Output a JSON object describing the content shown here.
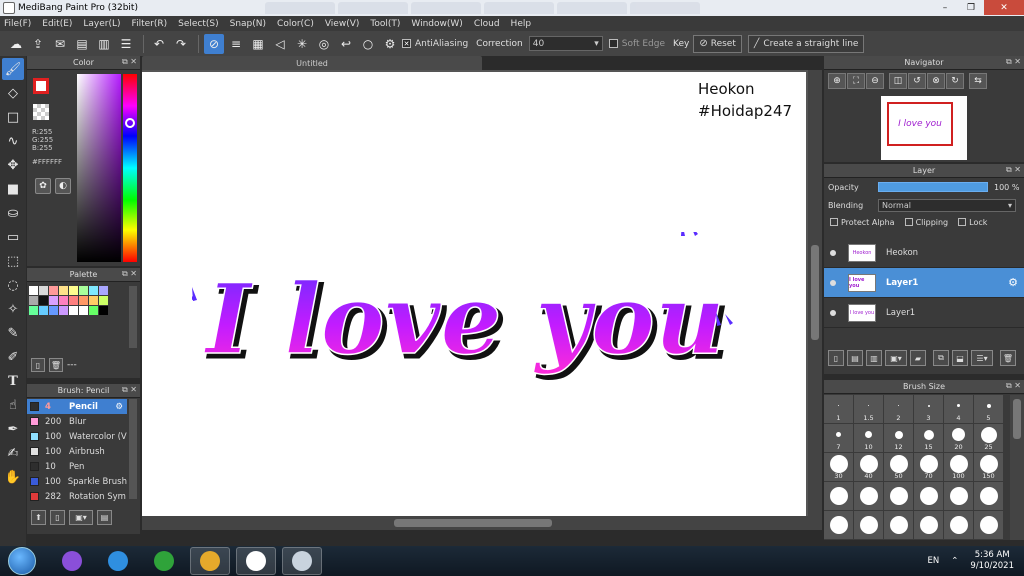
{
  "window": {
    "title": "MediBang Paint Pro (32bit)",
    "controls": [
      "–",
      "❐",
      "✕"
    ]
  },
  "menu": [
    "File(F)",
    "Edit(E)",
    "Layer(L)",
    "Filter(R)",
    "Select(S)",
    "Snap(N)",
    "Color(C)",
    "View(V)",
    "Tool(T)",
    "Window(W)",
    "Cloud",
    "Help"
  ],
  "toolbar": {
    "antialiasing_label": "AntiAliasing",
    "correction_label": "Correction",
    "correction_value": "40",
    "soft_edge_label": "Soft Edge",
    "key_label": "Key",
    "reset_label": "Reset",
    "straight_line_label": "Create a straight line"
  },
  "color_panel": {
    "title": "Color",
    "r": "R:255",
    "g": "G:255",
    "b": "B:255",
    "hex": "#FFFFFF",
    "foreground_color": "#ffffff",
    "accent": "#e02020"
  },
  "palette_panel": {
    "title": "Palette",
    "footer_text": "---",
    "colors": [
      "#ffffff",
      "#d9d9d9",
      "#ff9a9a",
      "#ffe18a",
      "#fffd8f",
      "#a8ff9b",
      "#7fe9ff",
      "#a9a6ff",
      "#aaaaaa",
      "#111111",
      "#d9a0ff",
      "#ff80c0",
      "#ff8080",
      "#ff9966",
      "#ffcc66",
      "#ccff66",
      "#66ff99",
      "#66ccff",
      "#6699ff",
      "#cc99ff",
      "#ffffff",
      "#ffffff",
      "#66ff66",
      "#000000"
    ]
  },
  "brush_panel": {
    "title": "Brush: Pencil",
    "brushes": [
      {
        "size": "4",
        "name": "Pencil",
        "color": "#2e2e2e"
      },
      {
        "size": "200",
        "name": "Blur",
        "color": "#ff9ad8"
      },
      {
        "size": "100",
        "name": "Watercolor (V",
        "color": "#8fe0ff"
      },
      {
        "size": "100",
        "name": "Airbrush",
        "color": "#e0e0e0"
      },
      {
        "size": "10",
        "name": "Pen",
        "color": "#2e2e2e"
      },
      {
        "size": "100",
        "name": "Sparkle Brush",
        "color": "#3a5bd9"
      },
      {
        "size": "282",
        "name": "Rotation Sym",
        "color": "#e03a3a"
      }
    ]
  },
  "document": {
    "tab_title": "Untitled",
    "watermark_line1": "Heokon",
    "watermark_line2": "#Hoidap247",
    "artwork_text": "I love you"
  },
  "navigator_panel": {
    "title": "Navigator",
    "preview_text": "I love you"
  },
  "layer_panel": {
    "title": "Layer",
    "opacity_label": "Opacity",
    "opacity_value": "100 %",
    "blending_label": "Blending",
    "blending_value": "Normal",
    "protect_alpha_label": "Protect Alpha",
    "clipping_label": "Clipping",
    "lock_label": "Lock",
    "layers": [
      {
        "name": "Heokon",
        "thumb": "Heokon",
        "selected": false
      },
      {
        "name": "Layer1",
        "thumb": "I love you",
        "selected": true
      },
      {
        "name": "Layer1",
        "thumb": "I love you",
        "selected": false
      }
    ]
  },
  "brush_size_panel": {
    "title": "Brush Size",
    "sizes": [
      "1",
      "1.5",
      "2",
      "3",
      "4",
      "5",
      "7",
      "10",
      "12",
      "15",
      "20",
      "25",
      "30",
      "40",
      "50",
      "70",
      "100",
      "150"
    ]
  },
  "taskbar": {
    "language": "EN",
    "time": "5:36 AM",
    "date": "9/10/2021",
    "apps": [
      {
        "name": "visual-studio",
        "color": "#8a4fd9"
      },
      {
        "name": "internet-explorer",
        "color": "#2f8fe0"
      },
      {
        "name": "unikey",
        "color": "#2fa33a"
      },
      {
        "name": "chrome",
        "color": "#e5a92b"
      },
      {
        "name": "medibang",
        "color": "#ffffff"
      },
      {
        "name": "paint",
        "color": "#c9d3de"
      }
    ]
  }
}
